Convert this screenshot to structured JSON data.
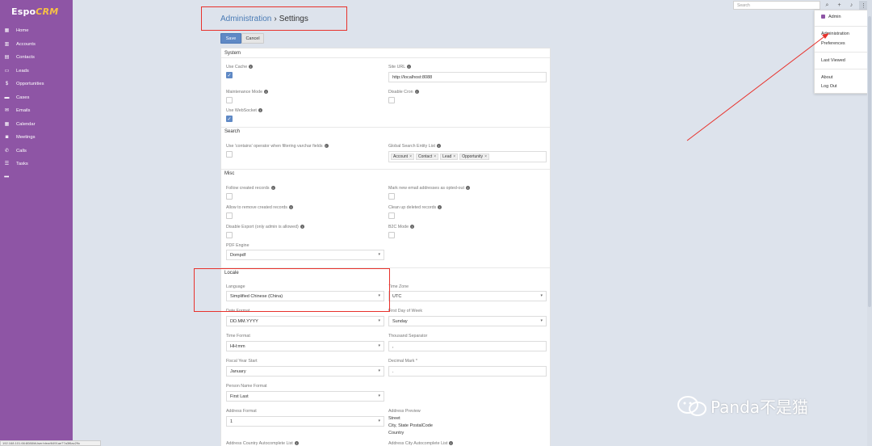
{
  "brand": {
    "logo_main": "Espo",
    "logo_accent": "CRM"
  },
  "sidebar": {
    "items": [
      {
        "label": "Home",
        "icon": "grid-icon"
      },
      {
        "label": "Accounts",
        "icon": "building-icon"
      },
      {
        "label": "Contacts",
        "icon": "contact-card-icon"
      },
      {
        "label": "Leads",
        "icon": "address-card-icon"
      },
      {
        "label": "Opportunities",
        "icon": "dollar-icon"
      },
      {
        "label": "Cases",
        "icon": "briefcase-icon"
      },
      {
        "label": "Emails",
        "icon": "envelope-icon"
      },
      {
        "label": "Calendar",
        "icon": "calendar-icon"
      },
      {
        "label": "Meetings",
        "icon": "meeting-icon"
      },
      {
        "label": "Calls",
        "icon": "phone-icon"
      },
      {
        "label": "Tasks",
        "icon": "list-icon"
      }
    ],
    "more_label": "•••"
  },
  "topbar": {
    "search_placeholder": "Search"
  },
  "user_menu": {
    "user": "Admin",
    "items": [
      "Administration",
      "Preferences",
      "Last Viewed",
      "About",
      "Log Out"
    ]
  },
  "header": {
    "breadcrumb_link": "Administration",
    "separator": "›",
    "current": "Settings"
  },
  "buttons": {
    "save": "Save",
    "cancel": "Cancel"
  },
  "sections": {
    "system": {
      "title": "System",
      "use_cache": "Use Cache",
      "site_url": "Site URL",
      "site_url_value": "http://localhost:8088",
      "maintenance_mode": "Maintenance Mode",
      "disable_cron": "Disable Cron",
      "use_websocket": "Use WebSocket"
    },
    "search": {
      "title": "Search",
      "contains_operator": "Use 'contains' operator when filtering varchar fields",
      "global_search_list": "Global Search Entity List",
      "entities": [
        "Account",
        "Contact",
        "Lead",
        "Opportunity"
      ]
    },
    "misc": {
      "title": "Misc",
      "follow_created": "Follow created records",
      "mark_opted_out": "Mark new email addresses as opted-out",
      "allow_remove": "Allow to remove created records",
      "clean_up": "Clean up deleted records",
      "disable_export": "Disable Export (only admin is allowed)",
      "b2c_mode": "B2C Mode",
      "pdf_engine": "PDF Engine",
      "pdf_engine_value": "Dompdf"
    },
    "locale": {
      "title": "Locale",
      "language": "Language",
      "language_value": "Simplified Chinese (China)",
      "time_zone": "Time Zone",
      "time_zone_value": "UTC",
      "date_format": "Date Format",
      "date_format_value": "DD.MM.YYYY",
      "first_day": "First Day of Week",
      "first_day_value": "Sunday",
      "time_format": "Time Format",
      "time_format_value": "HH:mm",
      "thousand_sep": "Thousand Separator",
      "thousand_sep_value": ",",
      "fiscal_year": "Fiscal Year Start",
      "fiscal_year_value": "January",
      "decimal_mark": "Decimal Mark *",
      "decimal_mark_value": ".",
      "person_name": "Person Name Format",
      "person_name_value": "First Last",
      "address_format": "Address Format",
      "address_format_value": "1",
      "address_preview": "Address Preview",
      "address_lines": [
        "Street",
        "City, State PostalCode",
        "Country"
      ],
      "country_autocomplete": "Address Country Autocomplete List",
      "city_autocomplete": "Address City Autocomplete List"
    }
  },
  "status_url": "192.168.101.66:8088/#User/view/6491ae77a3f6ac29c",
  "watermark": "Panda不是猫",
  "annotation_color": "#e8322c",
  "accent_color": "#8e55a5",
  "primary_button_color": "#5f89c5"
}
